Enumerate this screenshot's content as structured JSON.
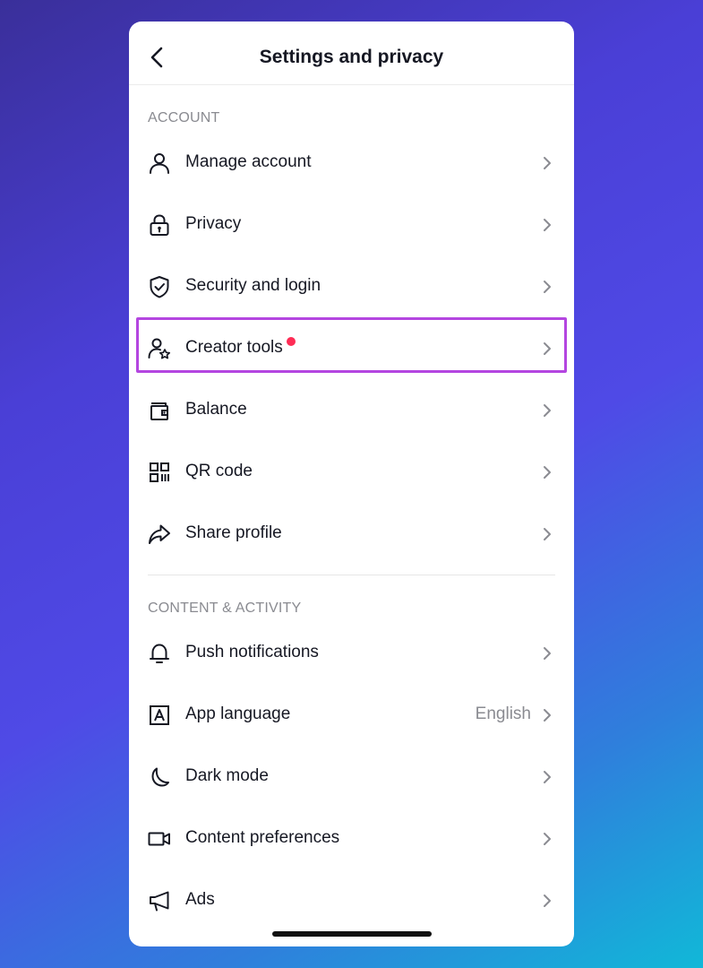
{
  "header": {
    "title": "Settings and privacy"
  },
  "sections": {
    "account": {
      "title": "ACCOUNT",
      "items": [
        {
          "label": "Manage account",
          "icon": "person-icon"
        },
        {
          "label": "Privacy",
          "icon": "lock-icon"
        },
        {
          "label": "Security and login",
          "icon": "shield-icon"
        },
        {
          "label": "Creator tools",
          "icon": "person-star-icon",
          "badge": true
        },
        {
          "label": "Balance",
          "icon": "wallet-icon"
        },
        {
          "label": "QR code",
          "icon": "qr-code-icon"
        },
        {
          "label": "Share profile",
          "icon": "share-arrow-icon"
        }
      ]
    },
    "content": {
      "title": "CONTENT & ACTIVITY",
      "items": [
        {
          "label": "Push notifications",
          "icon": "bell-icon"
        },
        {
          "label": "App language",
          "icon": "language-icon",
          "value": "English"
        },
        {
          "label": "Dark mode",
          "icon": "moon-icon"
        },
        {
          "label": "Content preferences",
          "icon": "video-camera-icon"
        },
        {
          "label": "Ads",
          "icon": "megaphone-icon"
        }
      ]
    }
  },
  "colors": {
    "highlight": "#b446e0",
    "badge": "#fe2c55",
    "text": "#161823",
    "secondary_text": "#8a8b91"
  }
}
